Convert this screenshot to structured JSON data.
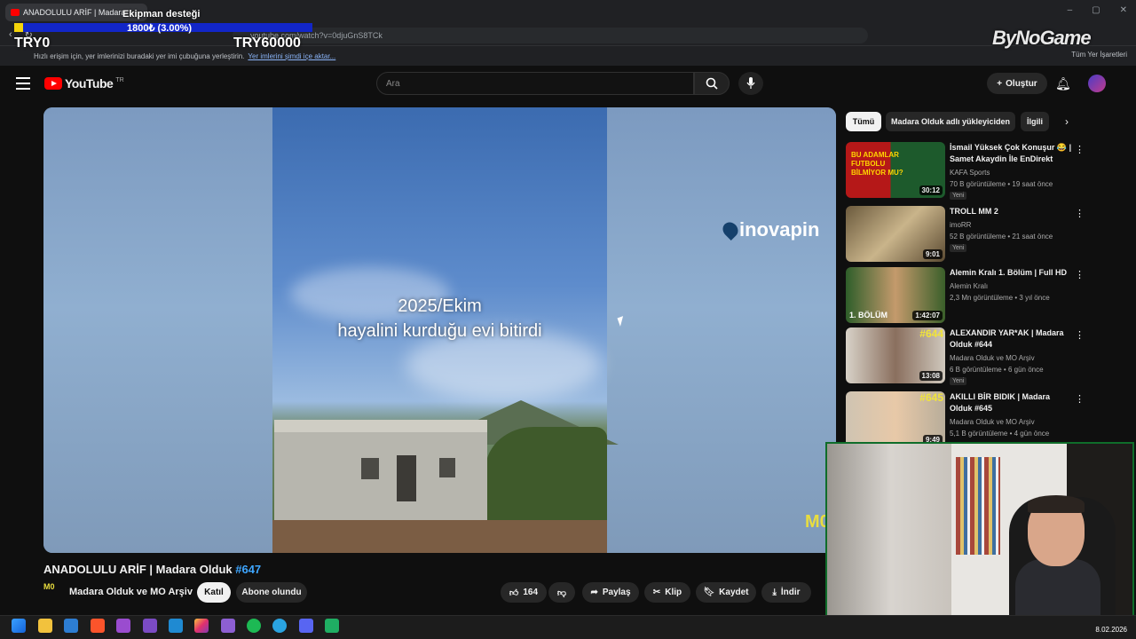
{
  "browser": {
    "tab_title": "ANADOLULU ARİF | Madara",
    "url": "youtube.com/watch?v=0djuGnS8TCk",
    "bookmarks_hint": "Hızlı erişim için, yer imlerinizi buradaki yer imi çubuğuna yerleştirin.",
    "bookmarks_link": "Yer imlerini şimdi içe aktar...",
    "bookmarks_right": "Tüm Yer İşaretleri"
  },
  "overlay": {
    "donation_title": "Ekipman desteği",
    "donation_amount": "1800₺ (3.00%)",
    "donation_progress": 0.03,
    "goal_min": "TRY0",
    "goal_max": "TRY60000",
    "brand": "ByNoGame"
  },
  "youtube": {
    "logo": "YouTube",
    "region": "TR",
    "search_placeholder": "Ara",
    "create_label": "Oluştur"
  },
  "video": {
    "caption_line1": "2025/Ekim",
    "caption_line2": "hayalini kurduğu evi bitirdi",
    "watermark": "inovapin",
    "channel_watermark": "M0",
    "title": "ANADOLULU ARİF | Madara Olduk",
    "title_tag": "#647",
    "channel_logo": "M0",
    "channel_name": "Madara Olduk ve MO Arşiv",
    "join_label": "Katıl",
    "subscribed_label": "Abone olundu",
    "likes": "164",
    "share_label": "Paylaş",
    "clip_label": "Klip",
    "save_label": "Kaydet",
    "download_label": "İndir"
  },
  "sidebar": {
    "chips": [
      "Tümü",
      "Madara Olduk adlı yükleyiciden",
      "İlgili"
    ],
    "items": [
      {
        "title": "İsmail Yüksek Çok Konuşur 😂 | Samet Akaydin İle EnDirekt",
        "channel": "KAFA Sports",
        "meta": "70 B görüntüleme • 19 saat önce",
        "badge": "Yeni",
        "duration": "30:12",
        "thumb_text": "BU ADAMLAR FUTBOLU BİLMİYOR MU?"
      },
      {
        "title": "TROLL MM 2",
        "channel": "imoRR",
        "meta": "52 B görüntüleme • 21 saat önce",
        "badge": "Yeni",
        "duration": "9:01",
        "thumb_text": ""
      },
      {
        "title": "Alemin Kralı 1. Bölüm | Full HD",
        "channel": "Alemin Kralı",
        "meta": "2,3 Mn görüntüleme • 3 yıl önce",
        "badge": "",
        "duration": "1:42:07",
        "thumb_text": "1. BÖLÜM"
      },
      {
        "title": "ALEXANDIR YAR*AK | Madara Olduk #644",
        "channel": "Madara Olduk ve MO Arşiv",
        "meta": "6 B görüntüleme • 6 gün önce",
        "badge": "Yeni",
        "duration": "13:08",
        "thumb_text": "#644"
      },
      {
        "title": "AKILLI BİR BIDIK | Madara Olduk #645",
        "channel": "Madara Olduk ve MO Arşiv",
        "meta": "5,1 B görüntüleme • 4 gün önce",
        "badge": "",
        "duration": "9:49",
        "thumb_text": "#645"
      }
    ]
  },
  "taskbar": {
    "date": "8.02.2026"
  },
  "colors": {
    "youtube_red": "#ff0000",
    "bg": "#0f0f0f",
    "overlay_bar": "#1226c8",
    "overlay_fill": "#f4d40a",
    "webcam_border": "#0f6d2a"
  }
}
